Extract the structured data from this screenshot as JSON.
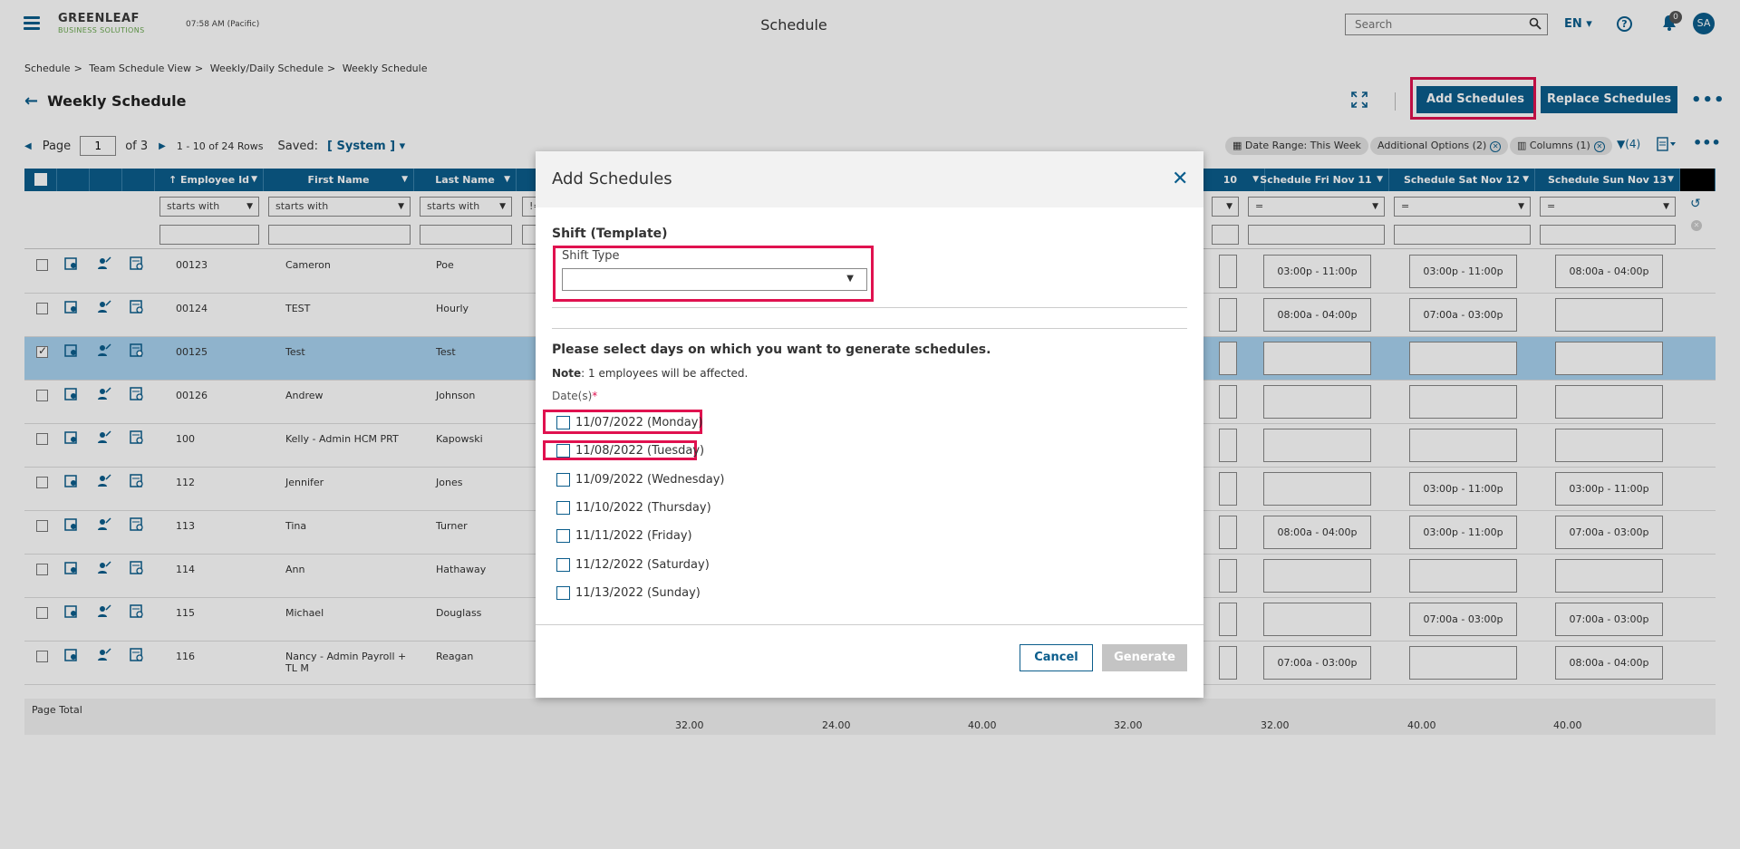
{
  "header": {
    "logo_top": "GREENLEAF",
    "logo_bottom": "BUSINESS SOLUTIONS",
    "clock": "07:58 AM (Pacific)",
    "app_title": "Schedule",
    "search_placeholder": "Search",
    "language": "EN",
    "help": "?",
    "notifications": "0",
    "avatar_initials": "SA"
  },
  "breadcrumb": [
    "Schedule",
    "Team Schedule View",
    "Weekly/Daily Schedule",
    "Weekly Schedule"
  ],
  "page": {
    "title": "Weekly Schedule",
    "add_button": "Add Schedules",
    "replace_button": "Replace Schedules",
    "more": "•••"
  },
  "pager": {
    "label": "Page",
    "current": "1",
    "of": "of 3",
    "rows": "1 - 10 of 24 Rows",
    "saved_label": "Saved:",
    "saved_value": "[ System ]"
  },
  "chips": {
    "date_range": "Date Range: This Week",
    "additional": "Additional Options (2)",
    "columns": "Columns (1)",
    "filter_count": "(4)"
  },
  "columns": {
    "employee_id": "Employee Id",
    "first_name": "First Name",
    "last_name": "Last Name",
    "thu_partial": "10",
    "fri": "Schedule Fri Nov 11",
    "sat": "Schedule Sat Nov 12",
    "sun": "Schedule Sun Nov 13"
  },
  "filters": {
    "starts_with": "starts with",
    "equals": "=",
    "not_equals": "!="
  },
  "rows": [
    {
      "id": "00123",
      "first": "Cameron",
      "last": "Poe",
      "fri": "03:00p - 11:00p",
      "sat": "03:00p - 11:00p",
      "sun": "08:00a - 04:00p",
      "selected": false
    },
    {
      "id": "00124",
      "first": "TEST",
      "last": "Hourly",
      "fri": "08:00a - 04:00p",
      "sat": "07:00a - 03:00p",
      "sun": "",
      "selected": false
    },
    {
      "id": "00125",
      "first": "Test",
      "last": "Test",
      "fri": "",
      "sat": "",
      "sun": "",
      "selected": true
    },
    {
      "id": "00126",
      "first": "Andrew",
      "last": "Johnson",
      "fri": "",
      "sat": "",
      "sun": "",
      "selected": false
    },
    {
      "id": "100",
      "first": "Kelly - Admin HCM PRT",
      "last": "Kapowski",
      "fri": "",
      "sat": "",
      "sun": "",
      "selected": false
    },
    {
      "id": "112",
      "first": "Jennifer",
      "last": "Jones",
      "fri": "",
      "sat": "03:00p - 11:00p",
      "sun": "03:00p - 11:00p",
      "selected": false
    },
    {
      "id": "113",
      "first": "Tina",
      "last": "Turner",
      "fri": "08:00a - 04:00p",
      "sat": "03:00p - 11:00p",
      "sun": "07:00a - 03:00p",
      "selected": false
    },
    {
      "id": "114",
      "first": "Ann",
      "last": "Hathaway",
      "fri": "",
      "sat": "",
      "sun": "",
      "selected": false
    },
    {
      "id": "115",
      "first": "Michael",
      "last": "Douglass",
      "fri": "",
      "sat": "07:00a - 03:00p",
      "sun": "07:00a - 03:00p",
      "selected": false
    },
    {
      "id": "116",
      "first": "Nancy - Admin Payroll + TL M",
      "last": "Reagan",
      "fri": "07:00a - 03:00p",
      "sat": "",
      "sun": "08:00a - 04:00p",
      "selected": false
    }
  ],
  "totals": {
    "label": "Page Total",
    "values": [
      "32.00",
      "24.00",
      "40.00",
      "32.00",
      "32.00",
      "40.00",
      "40.00"
    ]
  },
  "modal": {
    "title": "Add Schedules",
    "section": "Shift (Template)",
    "shift_type_label": "Shift Type",
    "shift_type_value": "",
    "prompt": "Please select days on which you want to generate schedules.",
    "note_label": "Note",
    "note_text": ": 1 employees will be affected.",
    "dates_label": "Date(s)",
    "required": "*",
    "days": [
      "11/07/2022 (Monday)",
      "11/08/2022 (Tuesday)",
      "11/09/2022 (Wednesday)",
      "11/10/2022 (Thursday)",
      "11/11/2022 (Friday)",
      "11/12/2022 (Saturday)",
      "11/13/2022 (Sunday)"
    ],
    "cancel": "Cancel",
    "generate": "Generate"
  },
  "colors": {
    "primary": "#0b5d8c",
    "highlight": "#e0114f",
    "selected_row": "#a9d3f0",
    "disabled": "#c4c4c4"
  }
}
